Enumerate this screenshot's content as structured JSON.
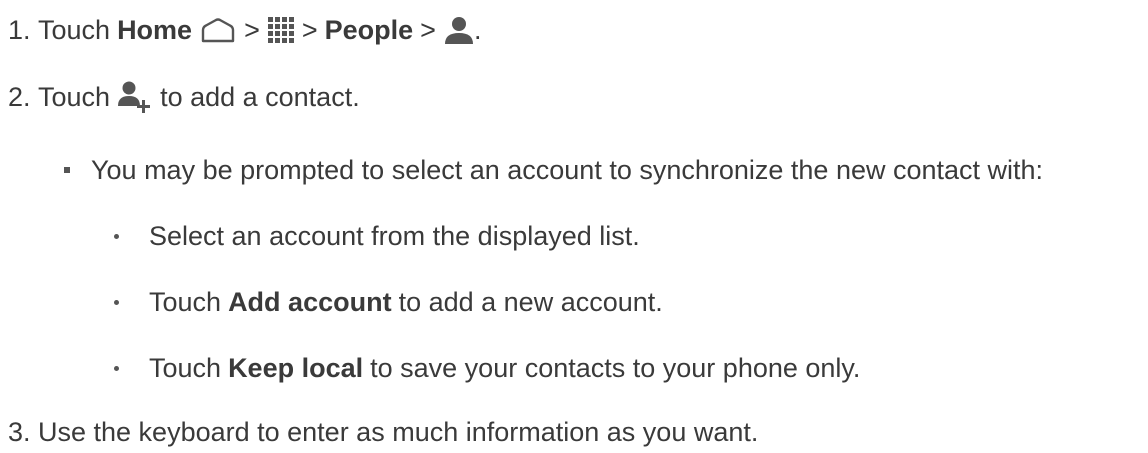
{
  "steps": [
    {
      "number": "1.",
      "pre": "Touch",
      "home_label": "Home",
      "sep1": ">",
      "sep2": ">",
      "people_label": "People",
      "sep3": ">",
      "end": "."
    },
    {
      "number": "2.",
      "pre": "Touch",
      "post": "to add a contact."
    },
    {
      "number": "3.",
      "text": "Use the keyboard to enter as much information as you want."
    }
  ],
  "note": "You may be prompted to select an account to synchronize the new contact with:",
  "options": [
    {
      "pre": "Select an account from the displayed list."
    },
    {
      "pre": "Touch",
      "bold": "Add account",
      "post": "to add a new account."
    },
    {
      "pre": "Touch",
      "bold": "Keep local",
      "post": "to save your contacts to your phone only."
    }
  ],
  "icons": {
    "home": "home-icon",
    "apps": "apps-grid-icon",
    "contact": "person-icon",
    "add_contact": "add-person-icon"
  },
  "colors": {
    "text": "#3a3a3a",
    "icon": "#555555"
  }
}
